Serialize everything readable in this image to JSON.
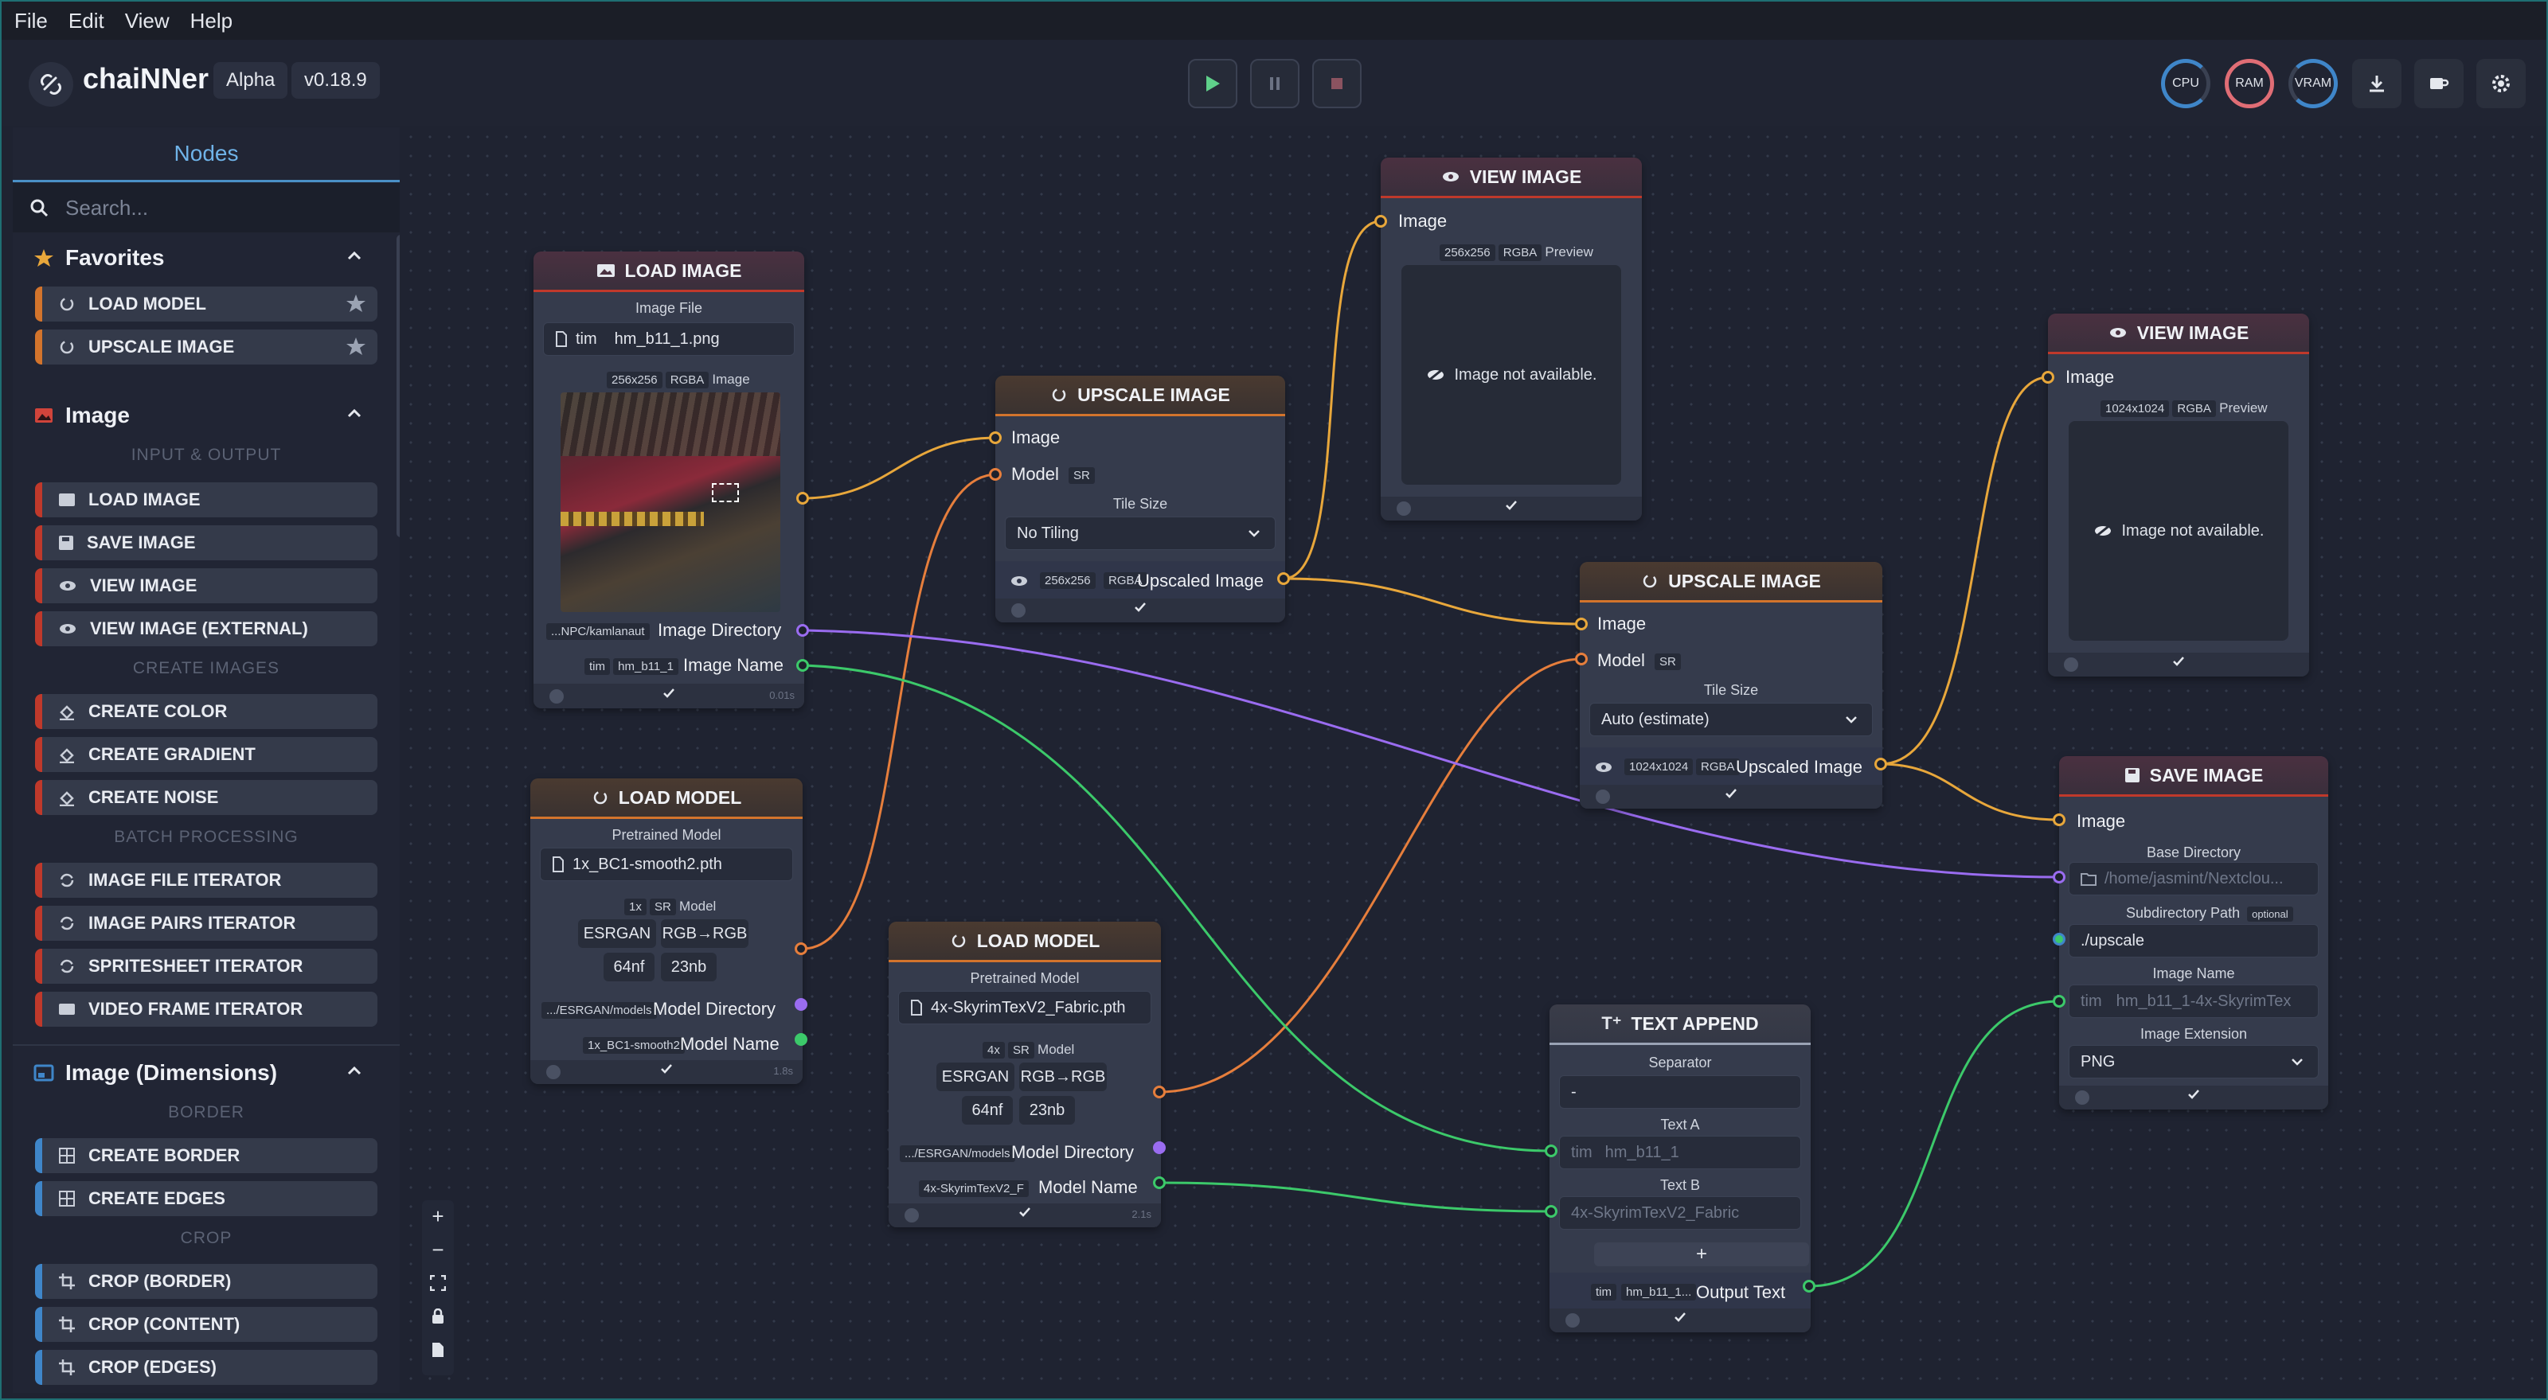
{
  "menu": [
    "File",
    "Edit",
    "View",
    "Help"
  ],
  "header": {
    "app_name": "chaiNNer",
    "channel": "Alpha",
    "version": "v0.18.9",
    "gauges": [
      "CPU",
      "RAM",
      "VRAM"
    ]
  },
  "sidebar": {
    "tab": "Nodes",
    "search_placeholder": "Search...",
    "favorites": {
      "title": "Favorites",
      "items": [
        "LOAD MODEL",
        "UPSCALE IMAGE"
      ]
    },
    "image": {
      "title": "Image",
      "sub_io": "INPUT & OUTPUT",
      "io": [
        "LOAD IMAGE",
        "SAVE IMAGE",
        "VIEW IMAGE",
        "VIEW IMAGE (EXTERNAL)"
      ],
      "sub_create": "CREATE IMAGES",
      "create": [
        "CREATE COLOR",
        "CREATE GRADIENT",
        "CREATE NOISE"
      ],
      "sub_batch": "BATCH PROCESSING",
      "batch": [
        "IMAGE FILE ITERATOR",
        "IMAGE PAIRS ITERATOR",
        "SPRITESHEET ITERATOR",
        "VIDEO FRAME ITERATOR"
      ]
    },
    "dims": {
      "title": "Image (Dimensions)",
      "sub_border": "BORDER",
      "border": [
        "CREATE BORDER",
        "CREATE EDGES"
      ],
      "sub_crop": "CROP",
      "crop": [
        "CROP (BORDER)",
        "CROP (CONTENT)",
        "CROP (EDGES)"
      ]
    }
  },
  "nodes": {
    "load_image": {
      "title": "LOAD IMAGE",
      "file_label": "Image File",
      "file_prefix": "tim",
      "file_value": "hm_b11_1.png",
      "meta": [
        "256x256",
        "RGBA",
        "Image"
      ],
      "dir_tag": "...NPC/kamlanaut",
      "dir_label": "Image Directory",
      "name_tag1": "tim",
      "name_tag2": "hm_b11_1",
      "name_label": "Image Name",
      "time": "0.01s"
    },
    "load_model_1": {
      "title": "LOAD MODEL",
      "pre_label": "Pretrained Model",
      "file": "1x_BC1-smooth2.pth",
      "meta": [
        "1x",
        "SR",
        "Model"
      ],
      "chips": [
        "ESRGAN",
        "RGB→RGB",
        "64nf",
        "23nb"
      ],
      "dir_tag": ".../ESRGAN/models",
      "dir_label": "Model Directory",
      "name_tag": "1x_BC1-smooth2",
      "name_label": "Model Name",
      "time": "1.8s"
    },
    "upscale_1": {
      "title": "UPSCALE IMAGE",
      "in_image": "Image",
      "in_model": "Model",
      "sr": "SR",
      "tile_label": "Tile Size",
      "tile_value": "No Tiling",
      "out_meta": [
        "256x256",
        "RGBA"
      ],
      "out_label": "Upscaled Image"
    },
    "load_model_2": {
      "title": "LOAD MODEL",
      "pre_label": "Pretrained Model",
      "file": "4x-SkyrimTexV2_Fabric.pth",
      "meta": [
        "4x",
        "SR",
        "Model"
      ],
      "chips": [
        "ESRGAN",
        "RGB→RGB",
        "64nf",
        "23nb"
      ],
      "dir_tag": ".../ESRGAN/models",
      "dir_label": "Model Directory",
      "name_tag": "4x-SkyrimTexV2_F",
      "name_label": "Model Name",
      "time": "2.1s"
    },
    "view_1": {
      "title": "VIEW IMAGE",
      "in_image": "Image",
      "meta": [
        "256x256",
        "RGBA",
        "Preview"
      ],
      "msg": "Image not available."
    },
    "upscale_2": {
      "title": "UPSCALE IMAGE",
      "in_image": "Image",
      "in_model": "Model",
      "sr": "SR",
      "tile_label": "Tile Size",
      "tile_value": "Auto (estimate)",
      "out_meta": [
        "1024x1024",
        "RGBA"
      ],
      "out_label": "Upscaled Image"
    },
    "text_append": {
      "title": "TEXT APPEND",
      "sep_label": "Separator",
      "sep_value": "-",
      "a_label": "Text A",
      "a_prefix": "tim",
      "a_value": "hm_b11_1",
      "b_label": "Text B",
      "b_value": "4x-SkyrimTexV2_Fabric",
      "plus": "+",
      "out_tag1": "tim",
      "out_tag2": "hm_b11_1...",
      "out_label": "Output Text"
    },
    "view_2": {
      "title": "VIEW IMAGE",
      "in_image": "Image",
      "meta": [
        "1024x1024",
        "RGBA",
        "Preview"
      ],
      "msg": "Image not available."
    },
    "save_image": {
      "title": "SAVE IMAGE",
      "in_image": "Image",
      "base_label": "Base Directory",
      "base_value": "/home/jasmint/Nextclou...",
      "sub_label": "Subdirectory Path",
      "sub_optional": "optional",
      "sub_value": "./upscale",
      "name_label": "Image Name",
      "name_prefix": "tim",
      "name_value": "hm_b11_1-4x-SkyrimTex",
      "ext_label": "Image Extension",
      "ext_value": "PNG"
    }
  },
  "colors": {
    "image": "#c0392b",
    "upscale": "#d3742c",
    "image_edge": "#e8a73b",
    "model_edge": "#e67e3c",
    "text_edge": "#3cc96a",
    "dir_edge": "#9a6cf0"
  }
}
